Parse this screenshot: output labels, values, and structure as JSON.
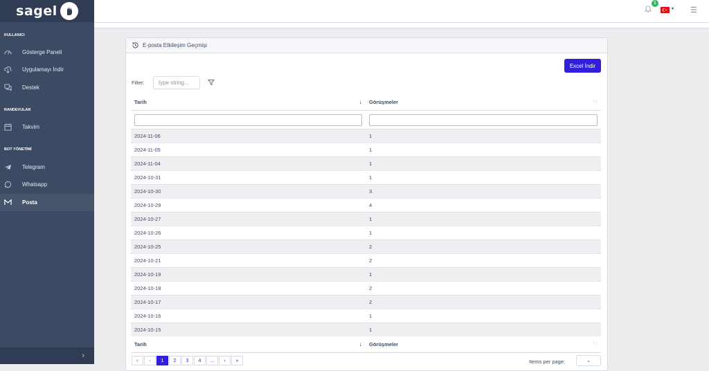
{
  "brand": {
    "name": "sagel"
  },
  "sidebar": {
    "sections": [
      {
        "title": "KULLANICI",
        "items": [
          {
            "label": "Gösterge Paneli",
            "icon": "speedometer-icon"
          },
          {
            "label": "Uygulamayı İndir",
            "icon": "cloud-download-icon"
          },
          {
            "label": "Destek",
            "icon": "chat-icon"
          }
        ]
      },
      {
        "title": "RANDEVULAR",
        "items": [
          {
            "label": "Takvim",
            "icon": "calendar-icon"
          }
        ]
      },
      {
        "title": "BOT YÖNETİMİ",
        "items": [
          {
            "label": "Telegram",
            "icon": "telegram-icon"
          },
          {
            "label": "Whatsapp",
            "icon": "whatsapp-icon"
          },
          {
            "label": "Posta",
            "icon": "gmail-icon",
            "active": true
          }
        ]
      }
    ],
    "collapse_icon": "chevron-right-icon"
  },
  "header": {
    "notification_count": "1",
    "language_flag": "turkey-flag-icon"
  },
  "card": {
    "title": "E-posta Etkileşim Geçmişi",
    "excel_button": "Excel İndir",
    "filter_label": "Filter:",
    "filter_placeholder": "type string..."
  },
  "table": {
    "columns": [
      "Tarih",
      "Görüşmeler"
    ],
    "rows": [
      [
        "2024-11-06",
        "1"
      ],
      [
        "2024-11-05",
        "1"
      ],
      [
        "2024-11-04",
        "1"
      ],
      [
        "2024-10-31",
        "1"
      ],
      [
        "2024-10-30",
        "3"
      ],
      [
        "2024-10-29",
        "4"
      ],
      [
        "2024-10-27",
        "1"
      ],
      [
        "2024-10-26",
        "1"
      ],
      [
        "2024-10-25",
        "2"
      ],
      [
        "2024-10-21",
        "2"
      ],
      [
        "2024-10-19",
        "1"
      ],
      [
        "2024-10-18",
        "2"
      ],
      [
        "2024-10-17",
        "2"
      ],
      [
        "2024-10-16",
        "1"
      ],
      [
        "2024-10-15",
        "1"
      ]
    ],
    "sort_column": "Tarih",
    "sort_direction": "descending"
  },
  "pagination": {
    "first": "«",
    "prev": "‹",
    "pages": [
      "1",
      "2",
      "3",
      "4"
    ],
    "active_page": "1",
    "ellipsis": "...",
    "next": "›",
    "last": "»",
    "items_per_page_label": "Items per page:"
  }
}
